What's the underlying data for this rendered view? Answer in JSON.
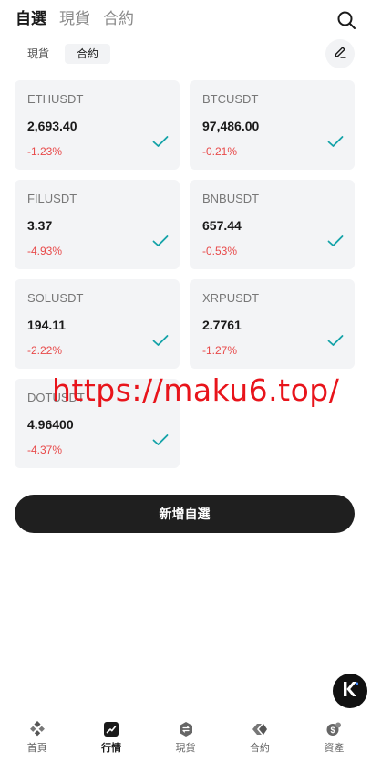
{
  "top_tabs": [
    "自選",
    "現貨",
    "合約"
  ],
  "sub_tabs": [
    "現貨",
    "合約"
  ],
  "watchlist": [
    {
      "symbol": "ETHUSDT",
      "price": "2,693.40",
      "change": "-1.23%"
    },
    {
      "symbol": "BTCUSDT",
      "price": "97,486.00",
      "change": "-0.21%"
    },
    {
      "symbol": "FILUSDT",
      "price": "3.37",
      "change": "-4.93%"
    },
    {
      "symbol": "BNBUSDT",
      "price": "657.44",
      "change": "-0.53%"
    },
    {
      "symbol": "SOLUSDT",
      "price": "194.11",
      "change": "-2.22%"
    },
    {
      "symbol": "XRPUSDT",
      "price": "2.7761",
      "change": "-1.27%"
    },
    {
      "symbol": "DOTUSDT",
      "price": "4.96400",
      "change": "-4.37%"
    }
  ],
  "watermark": "https://maku6.top/",
  "add_button_label": "新增自選",
  "bottom_nav": [
    "首頁",
    "行情",
    "現貨",
    "合約",
    "資產"
  ],
  "colors": {
    "negative": "#e84a4a",
    "check": "#14a3a8",
    "card_bg": "#f3f4f6",
    "button_bg": "#1f1f1f",
    "watermark": "#e8141b"
  }
}
